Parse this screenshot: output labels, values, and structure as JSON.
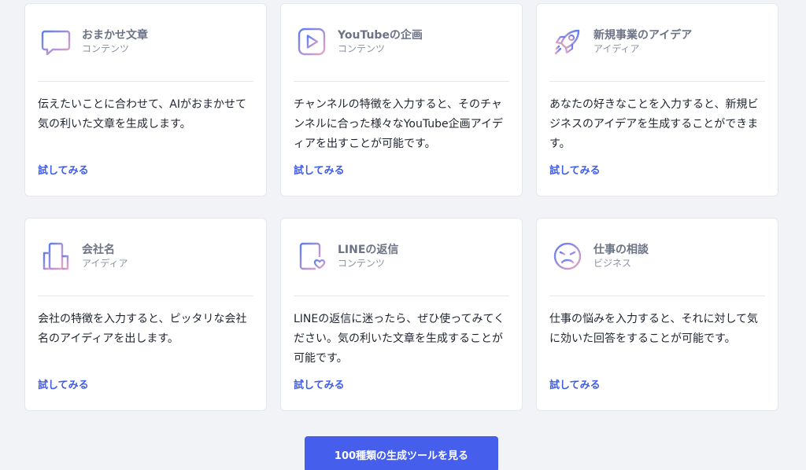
{
  "cards": [
    {
      "icon": "chat-text-icon",
      "title": "おまかせ文章",
      "category": "コンテンツ",
      "description": "伝えたいことに合わせて、AIがおまかせて気の利いた文章を生成します。",
      "link": "試してみる"
    },
    {
      "icon": "video-play-icon",
      "title": "YouTubeの企画",
      "category": "コンテンツ",
      "description": "チャンネルの特徴を入力すると、そのチャンネルに合った様々なYouTube企画アイディアを出すことが可能です。",
      "link": "試してみる"
    },
    {
      "icon": "rocket-icon",
      "title": "新規事業のアイデア",
      "category": "アイディア",
      "description": "あなたの好きなことを入力すると、新規ビジネスのアイデアを生成することができます。",
      "link": "試してみる"
    },
    {
      "icon": "building-icon",
      "title": "会社名",
      "category": "アイディア",
      "description": "会社の特徴を入力すると、ピッタリな会社名のアイディアを出します。",
      "link": "試してみる"
    },
    {
      "icon": "document-heart-icon",
      "title": "LINEの返信",
      "category": "コンテンツ",
      "description": "LINEの返信に迷ったら、ぜひ使ってみてください。気の利いた文章を生成することが可能です。",
      "link": "試してみる"
    },
    {
      "icon": "sad-face-icon",
      "title": "仕事の相談",
      "category": "ビジネス",
      "description": "仕事の悩みを入力すると、それに対して気に効いた回答をすることが可能です。",
      "link": "試してみる"
    }
  ],
  "cta": {
    "label": "100種類の生成ツールを見る"
  },
  "colors": {
    "accent": "#455fec",
    "link": "#3f5bea",
    "icon_gradient_start": "#5b7cf5",
    "icon_gradient_end": "#e8a4c0"
  }
}
